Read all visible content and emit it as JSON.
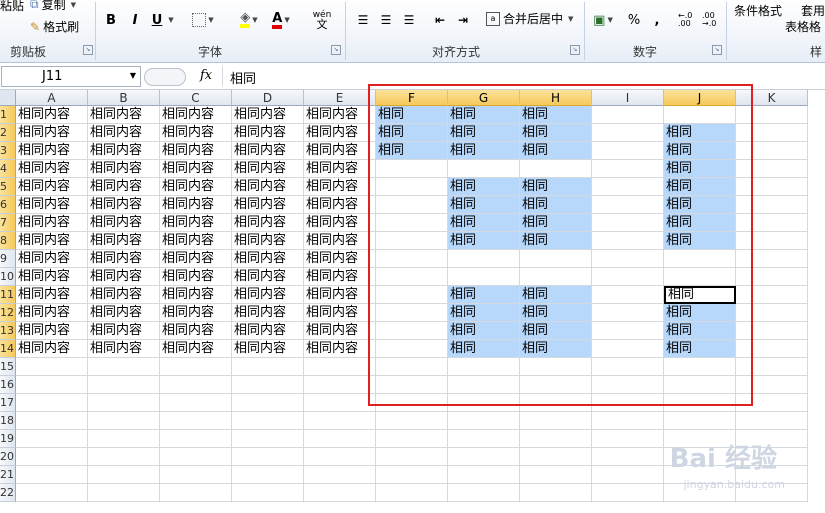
{
  "ribbon": {
    "clipboard": {
      "paste": "粘贴",
      "copy": "复制",
      "format_painter": "格式刷",
      "label": "剪贴板"
    },
    "font": {
      "bold": "B",
      "italic": "I",
      "underline": "U",
      "font_color_letter": "A",
      "phonetic": "wén",
      "phonetic_char": "文",
      "label": "字体"
    },
    "alignment": {
      "merge_center": "合并后居中",
      "label": "对齐方式"
    },
    "number": {
      "percent": "%",
      "comma": ",",
      "inc_decimal": "←.0 .00",
      "dec_decimal": ".00 →.0",
      "label": "数字"
    },
    "styles": {
      "conditional": "条件格式",
      "table_format": "套用",
      "table_format2": "表格格",
      "label": "样"
    }
  },
  "formula_bar": {
    "name_box": "J11",
    "fx": "fx",
    "value": "相同"
  },
  "columns": [
    "A",
    "B",
    "C",
    "D",
    "E",
    "F",
    "G",
    "H",
    "I",
    "J",
    "K"
  ],
  "selected_columns": [
    "F",
    "G",
    "H",
    "J"
  ],
  "rows": [
    "1",
    "2",
    "3",
    "4",
    "5",
    "6",
    "7",
    "8",
    "9",
    "10",
    "11",
    "12",
    "13",
    "14",
    "15",
    "16",
    "17",
    "18",
    "19",
    "20",
    "21",
    "22"
  ],
  "selected_rows": [
    "1",
    "2",
    "3",
    "4",
    "5",
    "6",
    "7",
    "8",
    "11",
    "12",
    "13",
    "14"
  ],
  "cells": {
    "full_text": "相同内容",
    "short_text": "相同",
    "a_to_e_rows": 14,
    "fgh_rows_filled": {
      "F": [
        1,
        2,
        3
      ],
      "G": [
        1,
        2,
        3,
        5,
        6,
        7,
        8,
        11,
        12,
        13,
        14
      ],
      "H": [
        1,
        2,
        3,
        5,
        6,
        7,
        8,
        11,
        12,
        13,
        14
      ]
    },
    "j_rows_filled": [
      2,
      3,
      4,
      5,
      6,
      7,
      8,
      11,
      12,
      13,
      14
    ],
    "active_cell": "J11"
  },
  "watermark": {
    "main": "Bai 经验",
    "sub": "jingyan.baidu.com"
  }
}
